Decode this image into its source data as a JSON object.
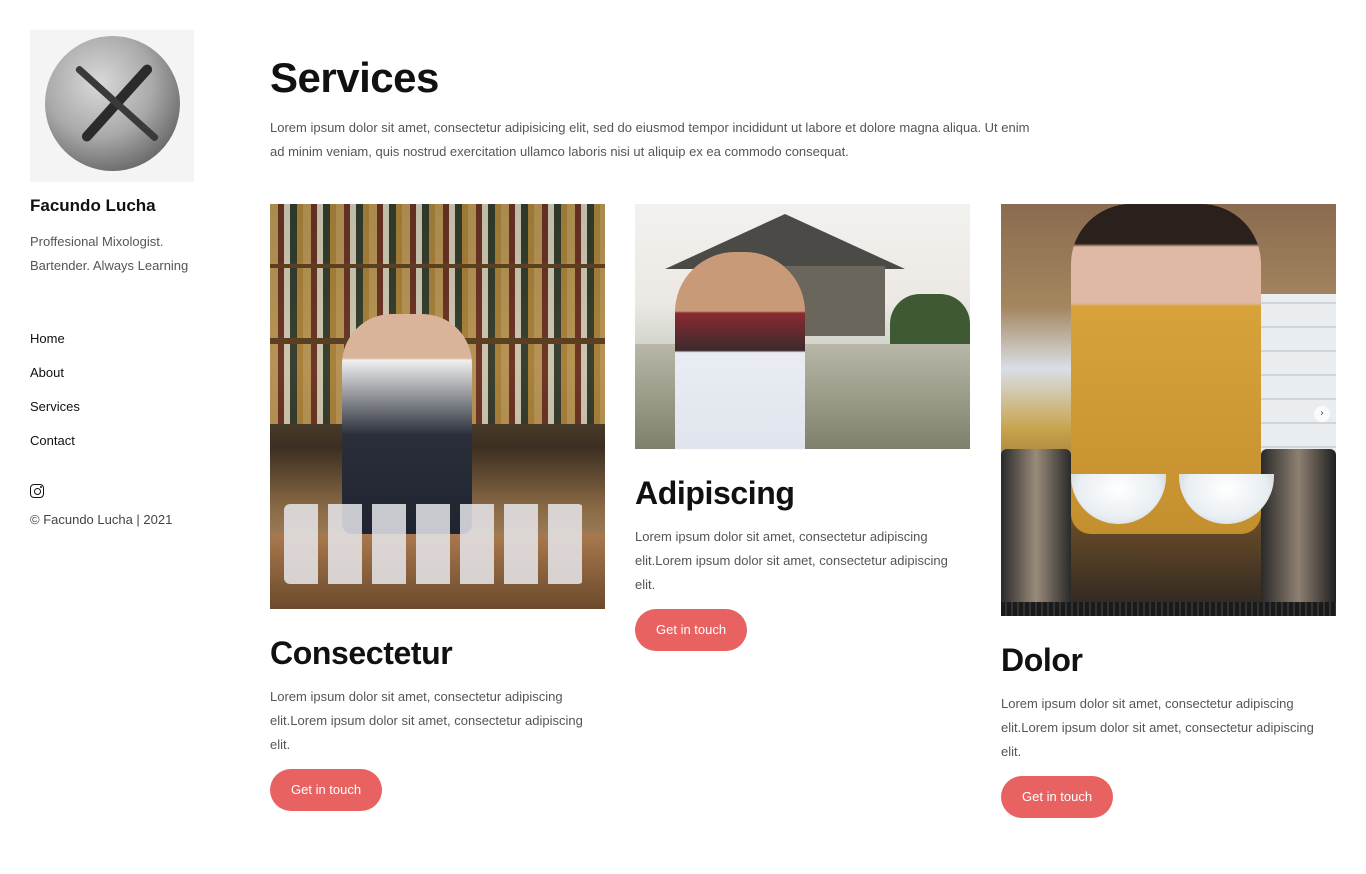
{
  "sidebar": {
    "name": "Facundo Lucha",
    "tagline": "Proffesional Mixologist. Bartender. Always Learning",
    "nav": [
      "Home",
      "About",
      "Services",
      "Contact"
    ],
    "social_icon": "instagram-icon",
    "copyright": "© Facundo Lucha | 2021"
  },
  "main": {
    "title": "Services",
    "intro": "Lorem ipsum dolor sit amet, consectetur adipisicing elit, sed do eiusmod tempor incididunt ut labore et dolore magna aliqua. Ut enim ad minim veniam, quis nostrud exercitation ullamco laboris nisi ut aliquip ex ea commodo consequat.",
    "cards": [
      {
        "title": "Consectetur",
        "text": "Lorem ipsum dolor sit amet, consectetur adipiscing elit.Lorem ipsum dolor sit amet, consectetur adipiscing elit.",
        "button": "Get in touch"
      },
      {
        "title": "Adipiscing",
        "text": "Lorem ipsum dolor sit amet, consectetur adipiscing elit.Lorem ipsum dolor sit amet, consectetur adipiscing elit.",
        "button": "Get in touch"
      },
      {
        "title": "Dolor",
        "text": "Lorem ipsum dolor sit amet, consectetur adipiscing elit.Lorem ipsum dolor sit amet, consectetur adipiscing elit.",
        "button": "Get in touch",
        "carousel_next_glyph": "›"
      }
    ]
  },
  "colors": {
    "accent": "#e86262",
    "text_primary": "#111111",
    "text_secondary": "#555555"
  }
}
